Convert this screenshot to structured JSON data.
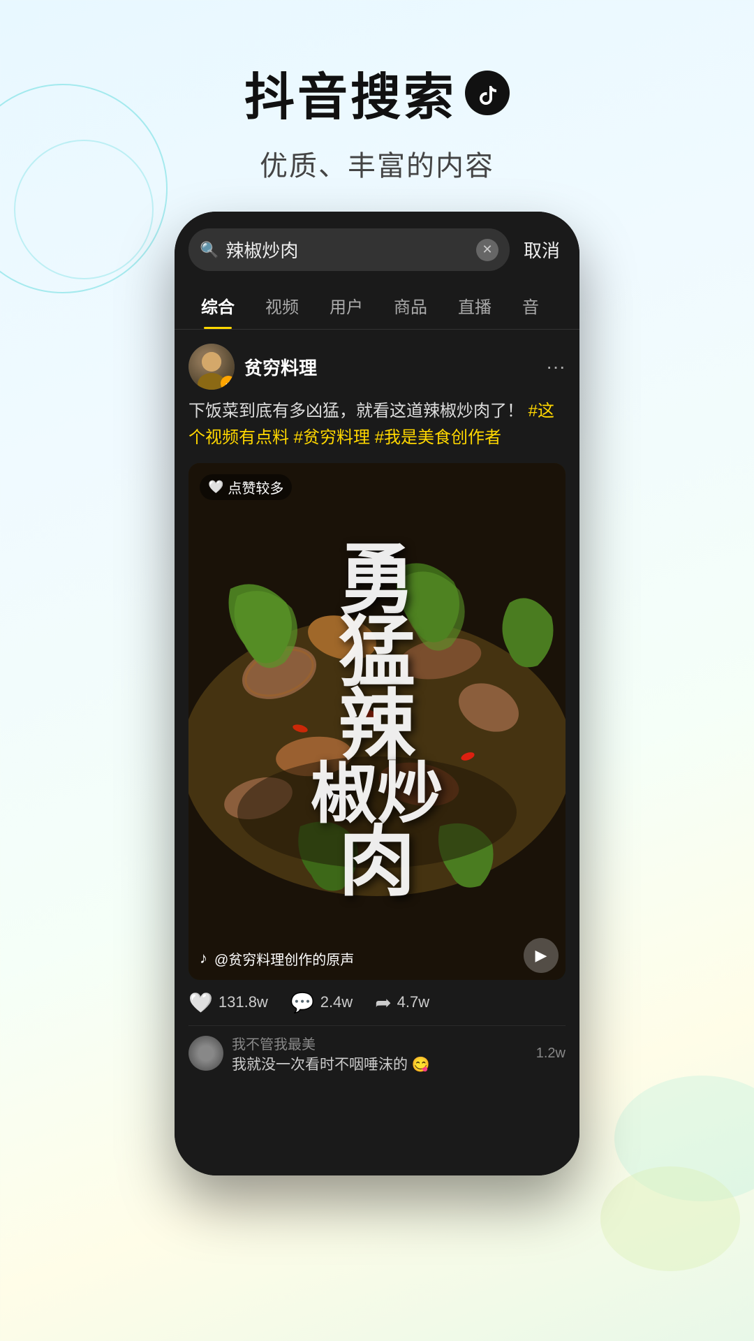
{
  "app": {
    "title": "抖音搜索",
    "logo_symbol": "♪",
    "subtitle": "优质、丰富的内容"
  },
  "search": {
    "query": "辣椒炒肉",
    "cancel_label": "取消",
    "placeholder": "辣椒炒肉"
  },
  "tabs": [
    {
      "label": "综合",
      "active": true
    },
    {
      "label": "视频",
      "active": false
    },
    {
      "label": "用户",
      "active": false
    },
    {
      "label": "商品",
      "active": false
    },
    {
      "label": "直播",
      "active": false
    },
    {
      "label": "音",
      "active": false
    }
  ],
  "post": {
    "username": "贫穷料理",
    "description": "下饭菜到底有多凶猛，就看这道辣椒炒肉了！",
    "hashtags": [
      "#这个视频有点料",
      "#贫穷料理",
      "#我是美食创作者"
    ],
    "video_label": "点赞较多",
    "video_title_line1": "勇",
    "video_title_line2": "猛",
    "video_title_line3": "辣",
    "video_title_line4": "椒炒",
    "video_title_line5": "肉",
    "video_text_full": "勇\n猛\n辣\n椒炒\n肉",
    "sound_text": "@贫穷料理创作的原声",
    "likes": "131.8w",
    "comments": "2.4w",
    "shares": "4.7w"
  },
  "comments": [
    {
      "author": "我不管我最美",
      "text": "我就没一次看时不咽唾沫的 😋",
      "count": "1.2w"
    }
  ],
  "icons": {
    "search": "🔍",
    "heart": "🤍",
    "comment": "💬",
    "share": "➦",
    "play": "▶",
    "music": "♪",
    "more": "···",
    "clear": "✕",
    "verified": "✓"
  }
}
